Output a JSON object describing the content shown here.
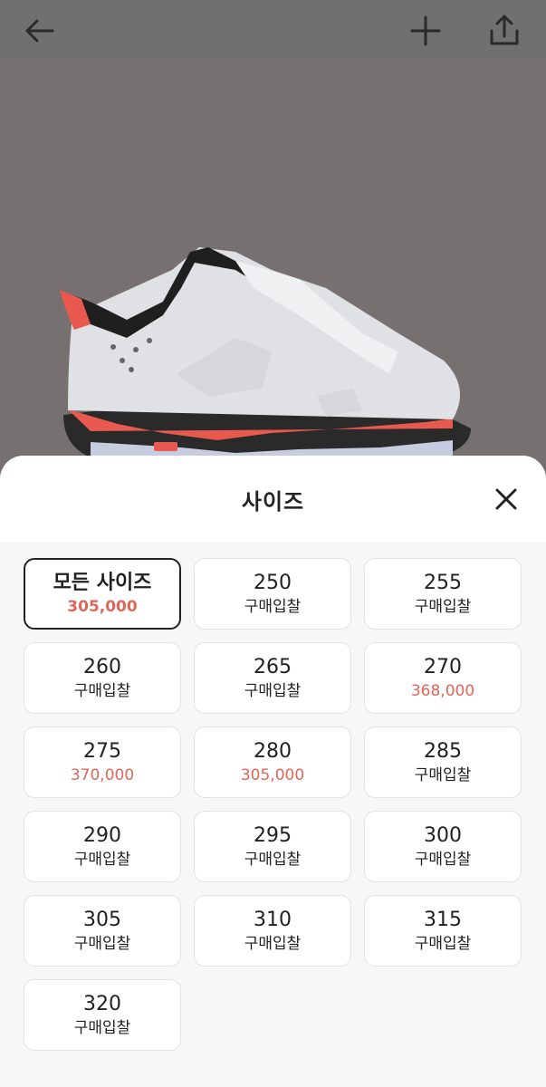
{
  "header": {
    "back_icon": "arrow-left-icon",
    "add_icon": "plus-icon",
    "share_icon": "share-icon"
  },
  "hero": {
    "image_alt": "sneaker-image"
  },
  "sheet": {
    "title": "사이즈",
    "close_icon": "close-icon",
    "options": [
      {
        "size": "모든 사이즈",
        "sub": "305,000",
        "is_price": true,
        "selected": true
      },
      {
        "size": "250",
        "sub": "구매입찰",
        "is_price": false
      },
      {
        "size": "255",
        "sub": "구매입찰",
        "is_price": false
      },
      {
        "size": "260",
        "sub": "구매입찰",
        "is_price": false
      },
      {
        "size": "265",
        "sub": "구매입찰",
        "is_price": false
      },
      {
        "size": "270",
        "sub": "368,000",
        "is_price": true
      },
      {
        "size": "275",
        "sub": "370,000",
        "is_price": true
      },
      {
        "size": "280",
        "sub": "305,000",
        "is_price": true
      },
      {
        "size": "285",
        "sub": "구매입찰",
        "is_price": false
      },
      {
        "size": "290",
        "sub": "구매입찰",
        "is_price": false
      },
      {
        "size": "295",
        "sub": "구매입찰",
        "is_price": false
      },
      {
        "size": "300",
        "sub": "구매입찰",
        "is_price": false
      },
      {
        "size": "305",
        "sub": "구매입찰",
        "is_price": false
      },
      {
        "size": "310",
        "sub": "구매입찰",
        "is_price": false
      },
      {
        "size": "315",
        "sub": "구매입찰",
        "is_price": false
      },
      {
        "size": "320",
        "sub": "구매입찰",
        "is_price": false
      }
    ]
  },
  "colors": {
    "price": "#e0665a",
    "text": "#222222",
    "overlay": "#6e6a6b"
  }
}
